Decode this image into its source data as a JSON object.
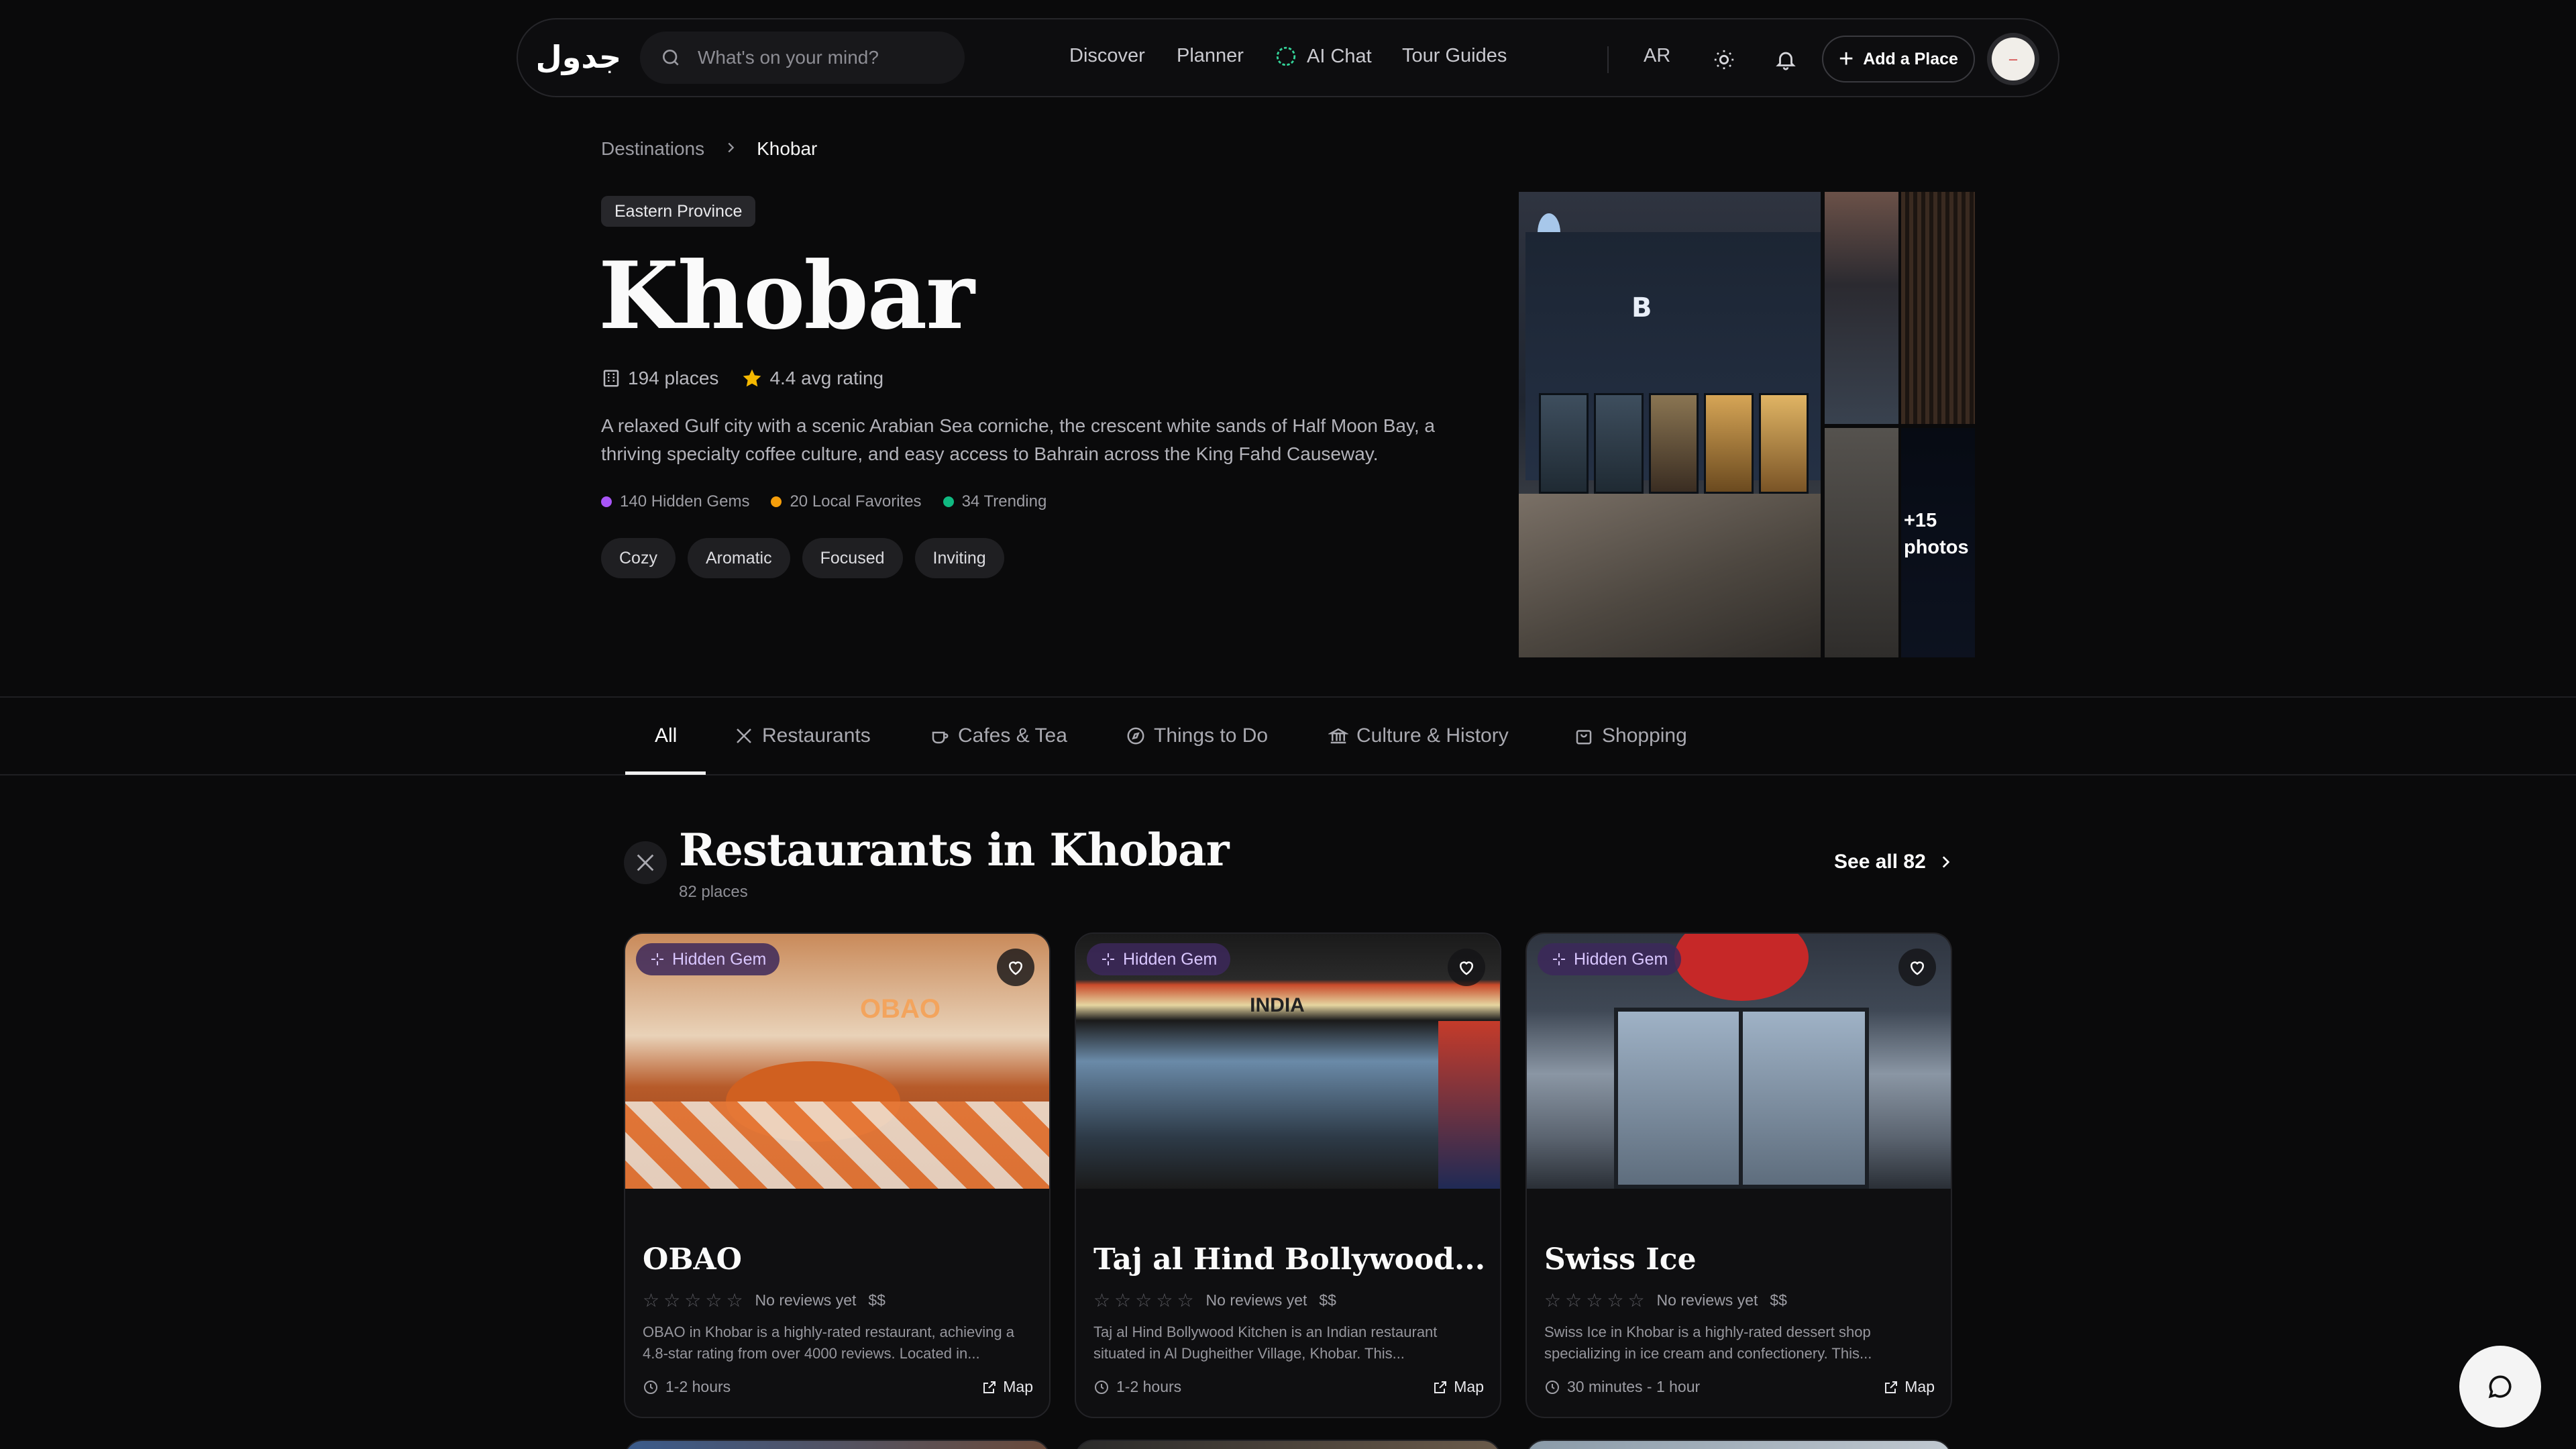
{
  "nav": {
    "logo_text": "جدول",
    "search_placeholder": "What's on your mind?",
    "links": [
      "Discover",
      "Planner",
      "AI Chat",
      "Tour Guides"
    ],
    "lang": "AR",
    "add_place": "Add a Place"
  },
  "breadcrumb": {
    "parent": "Destinations",
    "current": "Khobar"
  },
  "hero": {
    "region": "Eastern Province",
    "city": "Khobar",
    "places": "194 places",
    "rating": "4.4 avg rating",
    "description": "A relaxed Gulf city with a scenic Arabian Sea corniche, the crescent white sands of Half Moon Bay, a thriving specialty coffee culture, and easy access to Bahrain across the King Fahd Causeway.",
    "highlights": [
      {
        "label": "140 Hidden Gems",
        "color": "#a855f7"
      },
      {
        "label": "20 Local Favorites",
        "color": "#f59e0b"
      },
      {
        "label": "34 Trending",
        "color": "#10b981"
      }
    ],
    "moods": [
      "Cozy",
      "Aromatic",
      "Focused",
      "Inviting"
    ],
    "more_photos": "+15 photos",
    "photo_sign": "B"
  },
  "tabs": [
    {
      "label": "All",
      "icon": "none"
    },
    {
      "label": "Restaurants",
      "icon": "utensils-icon"
    },
    {
      "label": "Cafes & Tea",
      "icon": "cup-icon"
    },
    {
      "label": "Things to Do",
      "icon": "compass-icon"
    },
    {
      "label": "Culture & History",
      "icon": "landmark-icon"
    },
    {
      "label": "Shopping",
      "icon": "bag-icon"
    }
  ],
  "section": {
    "title": "Restaurants in Khobar",
    "count": "82 places",
    "see_all": "See all 82"
  },
  "cards": [
    {
      "badge": "Hidden Gem",
      "name": "OBAO",
      "reviews": "No reviews yet",
      "price": "$$",
      "blurb": "OBAO in Khobar is a highly-rated restaurant, achieving a 4.8-star rating from over 4000 reviews. Located in...",
      "duration": "1-2 hours",
      "map": "Map",
      "image_sign": "OBAO"
    },
    {
      "badge": "Hidden Gem",
      "name": "Taj al Hind Bollywood...",
      "reviews": "No reviews yet",
      "price": "$$",
      "blurb": "Taj al Hind Bollywood Kitchen is an Indian restaurant situated in Al Dugheither Village, Khobar. This...",
      "duration": "1-2 hours",
      "map": "Map",
      "image_sign": "INDIA"
    },
    {
      "badge": "Hidden Gem",
      "name": "Swiss Ice",
      "reviews": "No reviews yet",
      "price": "$$",
      "blurb": "Swiss Ice in Khobar is a highly-rated dessert shop specializing in ice cream and confectionery. This...",
      "duration": "30 minutes - 1 hour",
      "map": "Map"
    }
  ],
  "colors": {
    "background": "#0a0a0b",
    "badge": "#3c285a",
    "accent": "#ffffff"
  }
}
